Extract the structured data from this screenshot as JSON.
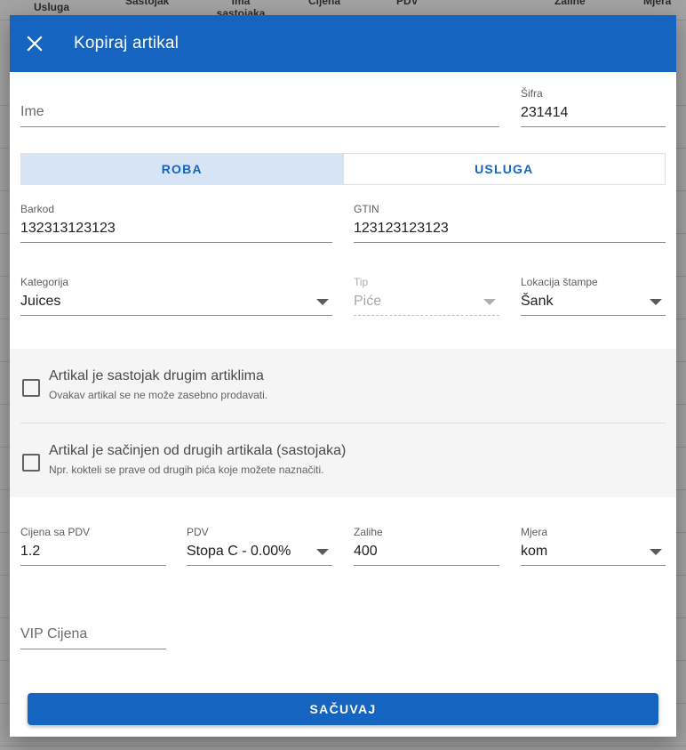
{
  "background_table": {
    "columns": [
      "Usluga",
      "Sastojak",
      "Ima sastojaka",
      "Cijena",
      "PDV",
      "Zalihe",
      "Mjera"
    ]
  },
  "dialog": {
    "title": "Kopiraj artikal",
    "close_icon": "close-icon",
    "ime": {
      "placeholder": "Ime",
      "value": ""
    },
    "sifra": {
      "label": "Šifra",
      "value": "231414"
    },
    "type_toggle": {
      "options": [
        "ROBA",
        "USLUGA"
      ],
      "selected": "ROBA"
    },
    "barkod": {
      "label": "Barkod",
      "value": "132313123123"
    },
    "gtin": {
      "label": "GTIN",
      "value": "123123123123"
    },
    "kategorija": {
      "label": "Kategorija",
      "value": "Juices"
    },
    "tip": {
      "label": "Tip",
      "value": "Piće",
      "disabled": true
    },
    "lokacija": {
      "label": "Lokacija štampe",
      "value": "Šank"
    },
    "checkbox_sastojak": {
      "title": "Artikal je sastojak drugim artiklima",
      "subtitle": "Ovakav artikal se ne može zasebno prodavati.",
      "checked": false
    },
    "checkbox_sacinjen": {
      "title": "Artikal je sačinjen od drugih artikala (sastojaka)",
      "subtitle": "Npr. kokteli se prave od drugih pića koje možete naznačiti.",
      "checked": false
    },
    "cijena": {
      "label": "Cijena sa PDV",
      "value": "1.2"
    },
    "pdv": {
      "label": "PDV",
      "value": "Stopa C - 0.00%"
    },
    "zalihe": {
      "label": "Zalihe",
      "value": "400"
    },
    "mjera": {
      "label": "Mjera",
      "value": "kom"
    },
    "vip_cijena": {
      "placeholder": "VIP Cijena",
      "value": ""
    },
    "save_label": "SAČUVAJ"
  },
  "colors": {
    "primary": "#1565c0",
    "toggle_active": "#d6e4f5",
    "panel": "#f5f5f5"
  }
}
